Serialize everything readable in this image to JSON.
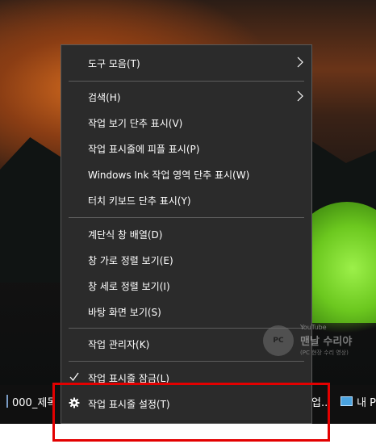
{
  "taskbar": {
    "left_item_label": "000_제목",
    "mid_item_label": "업...",
    "right_item_label": "내 P"
  },
  "context_menu": {
    "items": [
      {
        "label": "도구 모음(T)",
        "submenu": true
      },
      {
        "label": "검색(H)",
        "submenu": true
      },
      {
        "label": "작업 보기 단추 표시(V)"
      },
      {
        "label": "작업 표시줄에 피플 표시(P)"
      },
      {
        "label": "Windows Ink 작업 영역 단추 표시(W)"
      },
      {
        "label": "터치 키보드 단추 표시(Y)"
      },
      {
        "label": "계단식 창 배열(D)"
      },
      {
        "label": "창 가로 정렬 보기(E)"
      },
      {
        "label": "창 세로 정렬 보기(I)"
      },
      {
        "label": "바탕 화면 보기(S)"
      },
      {
        "label": "작업 관리자(K)"
      },
      {
        "label": "작업 표시줄 잠금(L)",
        "checked": true,
        "icon": "checkmark-icon"
      },
      {
        "label": "작업 표시줄 설정(T)",
        "icon": "gear-icon"
      }
    ]
  },
  "watermark": {
    "badge_text": "PC",
    "youtube_label": "YouTube",
    "channel_name": "맨날 수리야",
    "subtitle": "(PC 현장 수리 영상)"
  },
  "colors": {
    "menu_bg": "#2b2b2b",
    "menu_text": "#ffffff",
    "separator": "#5d5d5d",
    "highlight_box": "#e30000",
    "taskbar_bg": "#101010",
    "taskbar_accent": "#76b9ed"
  }
}
